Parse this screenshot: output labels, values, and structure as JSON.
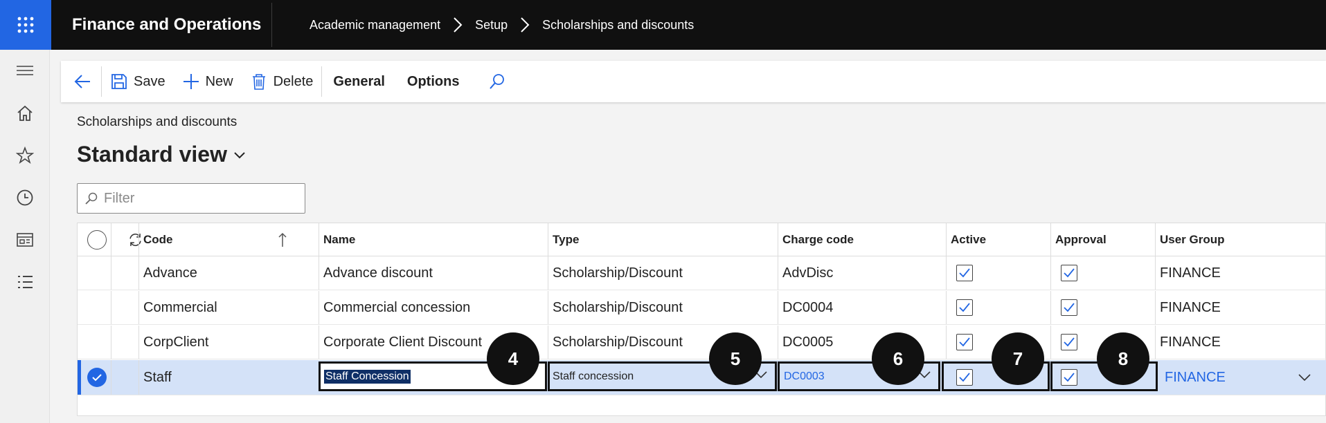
{
  "app": {
    "title": "Finance and Operations"
  },
  "breadcrumb": [
    "Academic management",
    "Setup",
    "Scholarships and discounts"
  ],
  "nav": [
    "hamburger-icon",
    "home-icon",
    "star-icon",
    "clock-icon",
    "workspace-icon",
    "list-icon"
  ],
  "actions": {
    "save": "Save",
    "new": "New",
    "delete": "Delete",
    "general": "General",
    "options": "Options"
  },
  "page": {
    "caption": "Scholarships and discounts",
    "view": "Standard view"
  },
  "filter": {
    "placeholder": "Filter"
  },
  "columns": {
    "code": "Code",
    "name": "Name",
    "type": "Type",
    "charge": "Charge code",
    "active": "Active",
    "approval": "Approval",
    "group": "User Group"
  },
  "rows": [
    {
      "code": "Advance",
      "name": "Advance discount",
      "type": "Scholarship/Discount",
      "charge": "AdvDisc",
      "active": true,
      "approval": true,
      "group": "FINANCE"
    },
    {
      "code": "Commercial",
      "name": "Commercial concession",
      "type": "Scholarship/Discount",
      "charge": "DC0004",
      "active": true,
      "approval": true,
      "group": "FINANCE"
    },
    {
      "code": "CorpClient",
      "name": "Corporate Client Discount",
      "type": "Scholarship/Discount",
      "charge": "DC0005",
      "active": true,
      "approval": true,
      "group": "FINANCE"
    },
    {
      "code": "Staff",
      "name": "Staff Concession",
      "type": "Staff concession",
      "charge": "DC0003",
      "active": true,
      "approval": true,
      "group": "FINANCE",
      "selected": true
    }
  ],
  "badges": [
    "4",
    "5",
    "6",
    "7",
    "8"
  ],
  "colors": {
    "accent": "#2266e3",
    "selected_row": "#d4e2f8",
    "topbar": "#101010"
  }
}
